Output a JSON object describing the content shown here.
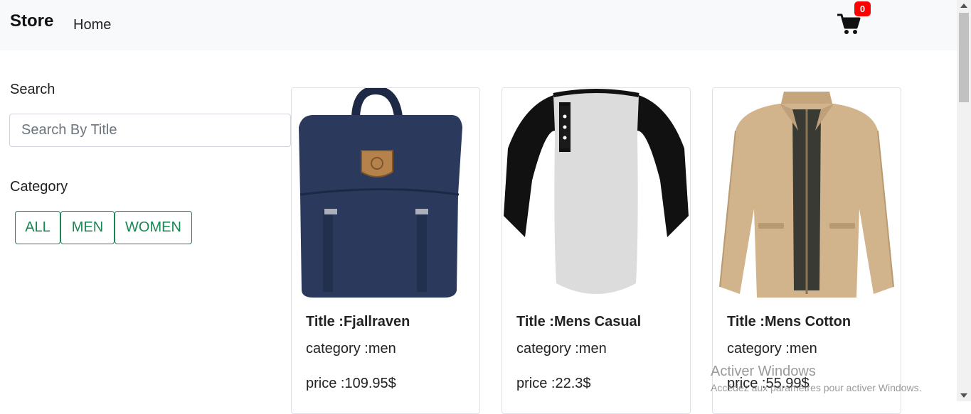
{
  "navbar": {
    "brand": "Store",
    "home": "Home",
    "cart_count": "0"
  },
  "sidebar": {
    "search_label": "Search",
    "search_placeholder": "Search By Title",
    "search_value": "",
    "category_label": "Category",
    "categories": [
      "ALL",
      "MEN",
      "WOMEN"
    ]
  },
  "products": [
    {
      "title": "Title :Fjallraven",
      "category": "category :men",
      "price": "price :109.95$",
      "image": "navy-backpack"
    },
    {
      "title": "Title :Mens Casual",
      "category": "category :men",
      "price": "price :22.3$",
      "image": "raglan-henley-shirt"
    },
    {
      "title": "Title :Mens Cotton",
      "category": "category :men",
      "price": "price :55.99$",
      "image": "khaki-cotton-jacket"
    }
  ],
  "watermark": {
    "title": "Activer Windows",
    "subtitle": "Accédez aux paramètres pour activer Windows."
  },
  "colors": {
    "accent": "#198754",
    "badge": "#ff0000",
    "navbar_bg": "#f8f9fa"
  }
}
